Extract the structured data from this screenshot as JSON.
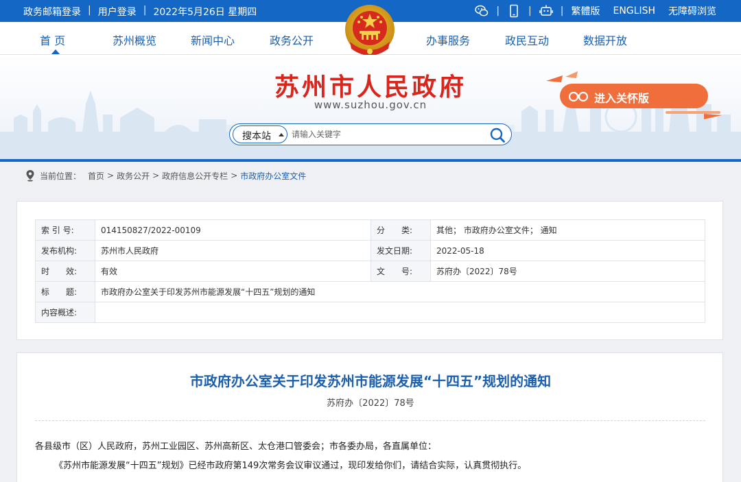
{
  "topbar": {
    "mail_login": "政务邮箱登录",
    "user_login": "用户登录",
    "date": "2022年5月26日 星期四",
    "sep": "|",
    "traditional": "繁體版",
    "english": "ENGLISH",
    "accessible": "无障碍浏览",
    "icons": [
      "wechat-icon",
      "mobile-icon",
      "robot-icon"
    ]
  },
  "nav": {
    "items": [
      "首 页",
      "苏州概览",
      "新闻中心",
      "政务公开",
      "办事服务",
      "政民互动",
      "数据开放"
    ],
    "active": "首 页"
  },
  "header": {
    "title": "苏州市人民政府",
    "url": "www.suzhou.gov.cn",
    "care_button": "进入关怀版"
  },
  "search": {
    "scope": "搜本站",
    "placeholder": "请输入关键字"
  },
  "breadcrumb": {
    "label": "当前位置：",
    "items": [
      "首页",
      "政务公开",
      "政府信息公开专栏"
    ],
    "current": "市政府办公室文件",
    "sep": ">"
  },
  "meta": {
    "index_label": "索 引 号:",
    "index_value": "014150827/2022-00109",
    "category_label": "分　　类:",
    "category_value": "其他；  市政府办公室文件；  通知",
    "publisher_label": "发布机构:",
    "publisher_value": "苏州市人民政府",
    "date_label": "发文日期:",
    "date_value": "2022-05-18",
    "validity_label": "时　　效:",
    "validity_value": "有效",
    "docno_label": "文　　号:",
    "docno_value": "苏府办〔2022〕78号",
    "title_label": "标　　题:",
    "title_value": "市政府办公室关于印发苏州市能源发展“十四五”规划的通知",
    "summary_label": "内容概述:",
    "summary_value": ""
  },
  "article": {
    "title": "市政府办公室关于印发苏州市能源发展“十四五”规划的通知",
    "doc_number": "苏府办〔2022〕78号",
    "salutation": "各县级市（区）人民政府，苏州工业园区、苏州高新区、太仓港口管委会；市各委办局，各直属单位：",
    "body": "《苏州市能源发展“十四五”规划》已经市政府第149次常务会议审议通过，现印发给你们，请结合实际，认真贯彻执行。"
  },
  "colors": {
    "brand_blue": "#1467c5",
    "title_red": "#d9261c",
    "care_orange": "#ef6e3c"
  }
}
